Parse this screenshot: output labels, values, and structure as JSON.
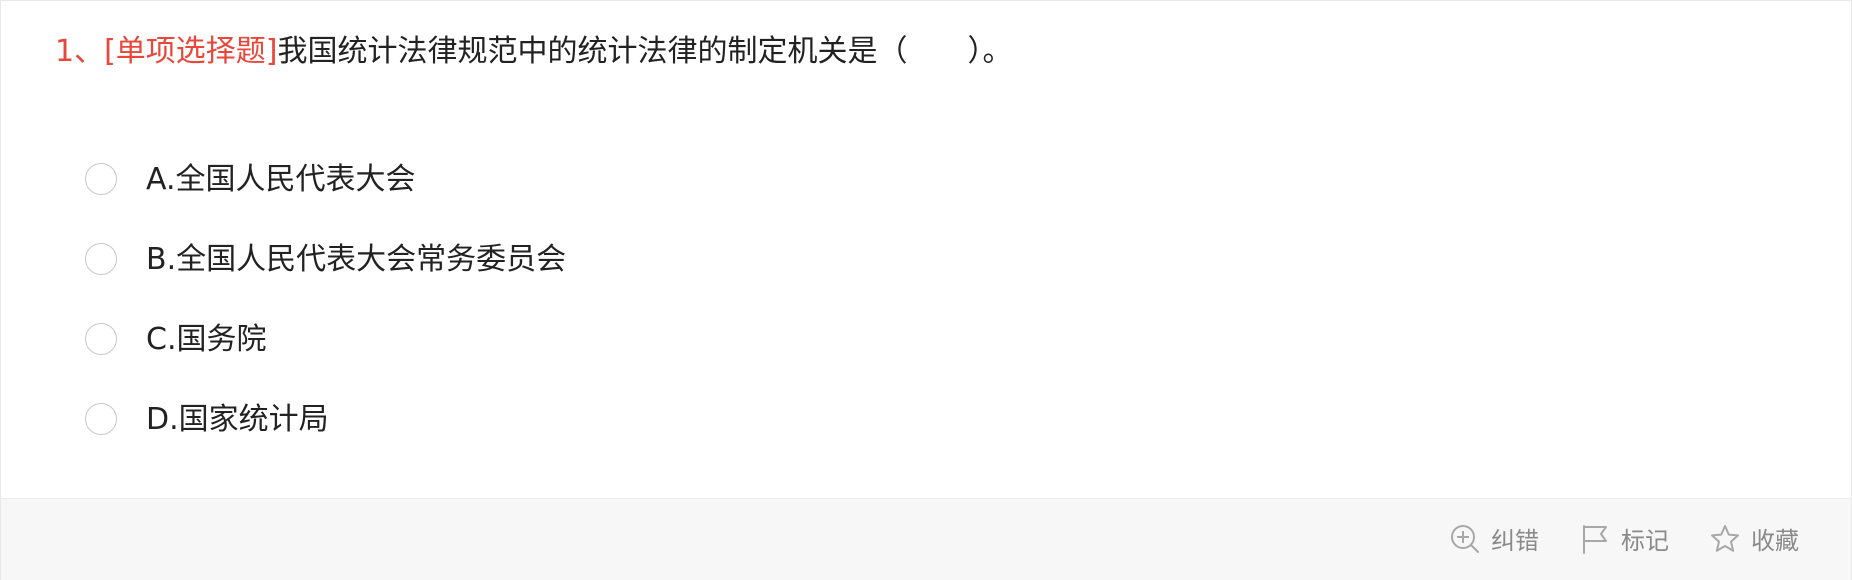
{
  "question": {
    "number": "1、",
    "type": "[单项选择题]",
    "text": "我国统计法律规范中的统计法律的制定机关是（　　）。"
  },
  "options": [
    {
      "label": "A.全国人民代表大会"
    },
    {
      "label": "B.全国人民代表大会常务委员会"
    },
    {
      "label": "C.国务院"
    },
    {
      "label": "D.国家统计局"
    }
  ],
  "footer": {
    "actions": [
      {
        "icon": "zoom-in-icon",
        "label": "纠错"
      },
      {
        "icon": "flag-icon",
        "label": "标记"
      },
      {
        "icon": "star-icon",
        "label": "收藏"
      }
    ]
  },
  "colors": {
    "accent": "#e8473a",
    "text": "#222222",
    "muted": "#8a8a8a",
    "footer_bg": "#f7f7f7"
  }
}
